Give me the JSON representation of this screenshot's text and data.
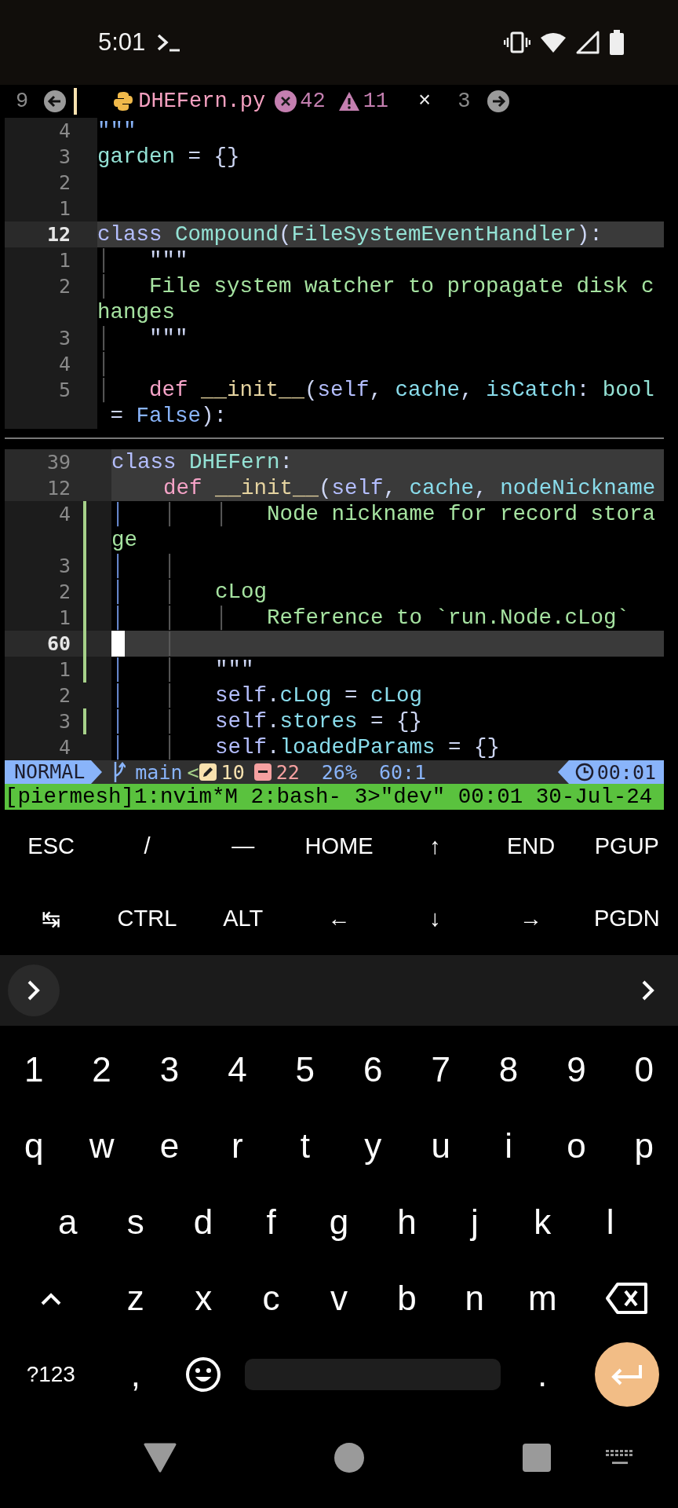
{
  "status_bar": {
    "time": "5:01"
  },
  "tabline": {
    "left_count": "9",
    "filename": "DHEFern.py",
    "errors": "42",
    "warnings": "11",
    "close": "×",
    "right_count": "3"
  },
  "panes": [
    {
      "rows": [
        {
          "number": "4",
          "highlighted": false,
          "current": false,
          "tokens": [
            {
              "kind": "quote",
              "text": "\"\"\""
            }
          ]
        },
        {
          "number": "3",
          "highlighted": false,
          "current": false,
          "tokens": [
            {
              "kind": "var",
              "text": "garden"
            },
            {
              "kind": "op",
              "text": " = {}"
            }
          ]
        },
        {
          "number": "2",
          "highlighted": false,
          "current": false
        },
        {
          "number": "1",
          "highlighted": false,
          "current": false
        },
        {
          "number": "12",
          "highlighted": true,
          "current": true,
          "tokens": [
            {
              "kind": "kw",
              "text": "class"
            },
            {
              "kind": "type",
              "text": " Compound"
            },
            {
              "kind": "op",
              "text": "("
            },
            {
              "kind": "type",
              "text": "FileSystemEventHandler"
            },
            {
              "kind": "op",
              "text": "):"
            }
          ]
        },
        {
          "number": "1",
          "highlighted": false,
          "current": false,
          "tokens": [
            {
              "kind": "guide",
              "text": "│   "
            },
            {
              "kind": "op",
              "text": "\"\"\""
            }
          ]
        },
        {
          "number": "2",
          "highlighted": false,
          "current": false,
          "tokens": [
            {
              "kind": "guide",
              "text": "│   "
            },
            {
              "kind": "str",
              "text": "File system watcher to propagate disk c"
            }
          ]
        },
        {
          "highlighted": false,
          "tokens": [
            {
              "kind": "str",
              "text": "hanges"
            }
          ]
        },
        {
          "number": "3",
          "highlighted": false,
          "current": false,
          "tokens": [
            {
              "kind": "guide",
              "text": "│   "
            },
            {
              "kind": "op",
              "text": "\"\"\""
            }
          ]
        },
        {
          "number": "4",
          "highlighted": false,
          "current": false,
          "tokens": [
            {
              "kind": "guide",
              "text": "│"
            }
          ]
        },
        {
          "number": "5",
          "highlighted": false,
          "current": false,
          "tokens": [
            {
              "kind": "guide",
              "text": "│   "
            },
            {
              "kind": "def",
              "text": "def"
            },
            {
              "kind": "fn",
              "text": " __init__"
            },
            {
              "kind": "op",
              "text": "("
            },
            {
              "kind": "self",
              "text": "self"
            },
            {
              "kind": "op",
              "text": ", "
            },
            {
              "kind": "param",
              "text": "cache"
            },
            {
              "kind": "op",
              "text": ", "
            },
            {
              "kind": "param",
              "text": "isCatch"
            },
            {
              "kind": "op",
              "text": ": "
            },
            {
              "kind": "type",
              "text": "bool"
            }
          ]
        },
        {
          "highlighted": false,
          "tokens": [
            {
              "kind": "op",
              "text": " = "
            },
            {
              "kind": "const",
              "text": "False"
            },
            {
              "kind": "op",
              "text": "):"
            }
          ]
        }
      ]
    },
    {
      "rows": [
        {
          "number": "39",
          "highlighted": true,
          "current": false,
          "changed": false,
          "cursor": false,
          "tokens": [
            {
              "kind": "kw",
              "text": "class"
            },
            {
              "kind": "type",
              "text": " DHEFern"
            },
            {
              "kind": "op",
              "text": ":"
            }
          ]
        },
        {
          "number": "12",
          "highlighted": true,
          "current": false,
          "changed": false,
          "cursor": false,
          "tokens": [
            {
              "kind": "def",
              "text": "    def"
            },
            {
              "kind": "fn",
              "text": " __init__"
            },
            {
              "kind": "op",
              "text": "("
            },
            {
              "kind": "self",
              "text": "self"
            },
            {
              "kind": "op",
              "text": ", "
            },
            {
              "kind": "param",
              "text": "cache"
            },
            {
              "kind": "op",
              "text": ", "
            },
            {
              "kind": "param",
              "text": "nodeNickname"
            }
          ]
        },
        {
          "number": "4",
          "highlighted": false,
          "current": false,
          "changed": true,
          "cursor": false,
          "tokens": [
            {
              "kind": "guide-active",
              "text": "│   "
            },
            {
              "kind": "guide",
              "text": "│   │   "
            },
            {
              "kind": "str",
              "text": "Node nickname for record stora"
            }
          ]
        },
        {
          "highlighted": false,
          "changed": true,
          "cursor": false,
          "tokens": [
            {
              "kind": "str",
              "text": "ge"
            }
          ]
        },
        {
          "number": "3",
          "highlighted": false,
          "current": false,
          "changed": true,
          "cursor": false,
          "tokens": [
            {
              "kind": "guide-active",
              "text": "│   "
            },
            {
              "kind": "guide",
              "text": "│"
            }
          ]
        },
        {
          "number": "2",
          "highlighted": false,
          "current": false,
          "changed": true,
          "cursor": false,
          "tokens": [
            {
              "kind": "guide-active",
              "text": "│   "
            },
            {
              "kind": "guide",
              "text": "│   "
            },
            {
              "kind": "str",
              "text": "cLog"
            }
          ]
        },
        {
          "number": "1",
          "highlighted": false,
          "current": false,
          "changed": true,
          "cursor": false,
          "tokens": [
            {
              "kind": "guide-active",
              "text": "│   "
            },
            {
              "kind": "guide",
              "text": "│   │   "
            },
            {
              "kind": "str",
              "text": "Reference to `run.Node.cLog`"
            }
          ]
        },
        {
          "number": "60",
          "highlighted": true,
          "current": true,
          "changed": true,
          "cursor": true,
          "tokens": [
            {
              "kind": "guide",
              "text": "   │"
            }
          ]
        },
        {
          "number": "1",
          "highlighted": false,
          "current": false,
          "changed": true,
          "cursor": false,
          "tokens": [
            {
              "kind": "guide-active",
              "text": "│   "
            },
            {
              "kind": "guide",
              "text": "│   "
            },
            {
              "kind": "op",
              "text": "\"\"\""
            }
          ]
        },
        {
          "number": "2",
          "highlighted": false,
          "current": false,
          "changed": false,
          "cursor": false,
          "tokens": [
            {
              "kind": "guide-active",
              "text": "│   "
            },
            {
              "kind": "guide",
              "text": "│   "
            },
            {
              "kind": "self",
              "text": "self"
            },
            {
              "kind": "op",
              "text": "."
            },
            {
              "kind": "attr",
              "text": "cLog"
            },
            {
              "kind": "op",
              "text": " = "
            },
            {
              "kind": "attr",
              "text": "cLog"
            }
          ]
        },
        {
          "number": "3",
          "highlighted": false,
          "current": false,
          "changed": true,
          "cursor": false,
          "tokens": [
            {
              "kind": "guide-active",
              "text": "│   "
            },
            {
              "kind": "guide",
              "text": "│   "
            },
            {
              "kind": "self",
              "text": "self"
            },
            {
              "kind": "op",
              "text": "."
            },
            {
              "kind": "attr",
              "text": "stores"
            },
            {
              "kind": "op",
              "text": " = {}"
            }
          ]
        },
        {
          "number": "4",
          "highlighted": false,
          "current": false,
          "changed": false,
          "cursor": false,
          "tokens": [
            {
              "kind": "guide-active",
              "text": "│   "
            },
            {
              "kind": "guide",
              "text": "│   "
            },
            {
              "kind": "self",
              "text": "self"
            },
            {
              "kind": "op",
              "text": "."
            },
            {
              "kind": "attr",
              "text": "loadedParams"
            },
            {
              "kind": "op",
              "text": " = {}"
            }
          ]
        }
      ]
    }
  ],
  "statusline": {
    "mode": "NORMAL",
    "branch": "main",
    "separator": "<",
    "changed": "10",
    "removed": "22",
    "percent": "26%",
    "position": "60:1",
    "time": "00:01"
  },
  "tmux": {
    "session": "[piermesh]",
    "windows": [
      "1:nvim*M",
      "2:bash-",
      "3>\"dev\""
    ],
    "time": "00:01",
    "date": "30-Jul-24"
  },
  "extra_keys": [
    [
      "ESC",
      "/",
      "—",
      "HOME",
      "↑",
      "END",
      "PGUP"
    ],
    [
      "↹",
      "CTRL",
      "ALT",
      "←",
      "↓",
      "→",
      "PGDN"
    ]
  ],
  "keyboard": [
    [
      {
        "kind": "char",
        "label": "1"
      },
      {
        "kind": "char",
        "label": "2"
      },
      {
        "kind": "char",
        "label": "3"
      },
      {
        "kind": "char",
        "label": "4"
      },
      {
        "kind": "char",
        "label": "5"
      },
      {
        "kind": "char",
        "label": "6"
      },
      {
        "kind": "char",
        "label": "7"
      },
      {
        "kind": "char",
        "label": "8"
      },
      {
        "kind": "char",
        "label": "9"
      },
      {
        "kind": "char",
        "label": "0"
      }
    ],
    [
      {
        "kind": "char",
        "label": "q"
      },
      {
        "kind": "char",
        "label": "w"
      },
      {
        "kind": "char",
        "label": "e"
      },
      {
        "kind": "char",
        "label": "r"
      },
      {
        "kind": "char",
        "label": "t"
      },
      {
        "kind": "char",
        "label": "y"
      },
      {
        "kind": "char",
        "label": "u"
      },
      {
        "kind": "char",
        "label": "i"
      },
      {
        "kind": "char",
        "label": "o"
      },
      {
        "kind": "char",
        "label": "p"
      }
    ],
    [
      {
        "kind": "char",
        "label": "a"
      },
      {
        "kind": "char",
        "label": "s"
      },
      {
        "kind": "char",
        "label": "d"
      },
      {
        "kind": "char",
        "label": "f"
      },
      {
        "kind": "char",
        "label": "g"
      },
      {
        "kind": "char",
        "label": "h"
      },
      {
        "kind": "char",
        "label": "j"
      },
      {
        "kind": "char",
        "label": "k"
      },
      {
        "kind": "char",
        "label": "l"
      }
    ],
    [
      {
        "kind": "shift"
      },
      {
        "kind": "char",
        "label": "z"
      },
      {
        "kind": "char",
        "label": "x"
      },
      {
        "kind": "char",
        "label": "c"
      },
      {
        "kind": "char",
        "label": "v"
      },
      {
        "kind": "char",
        "label": "b"
      },
      {
        "kind": "char",
        "label": "n"
      },
      {
        "kind": "char",
        "label": "m"
      },
      {
        "kind": "backspace"
      }
    ],
    [
      {
        "kind": "symbols",
        "label": "?123"
      },
      {
        "kind": "char",
        "label": ","
      },
      {
        "kind": "emoji"
      },
      {
        "kind": "space"
      },
      {
        "kind": "char",
        "label": "."
      },
      {
        "kind": "enter"
      }
    ]
  ]
}
